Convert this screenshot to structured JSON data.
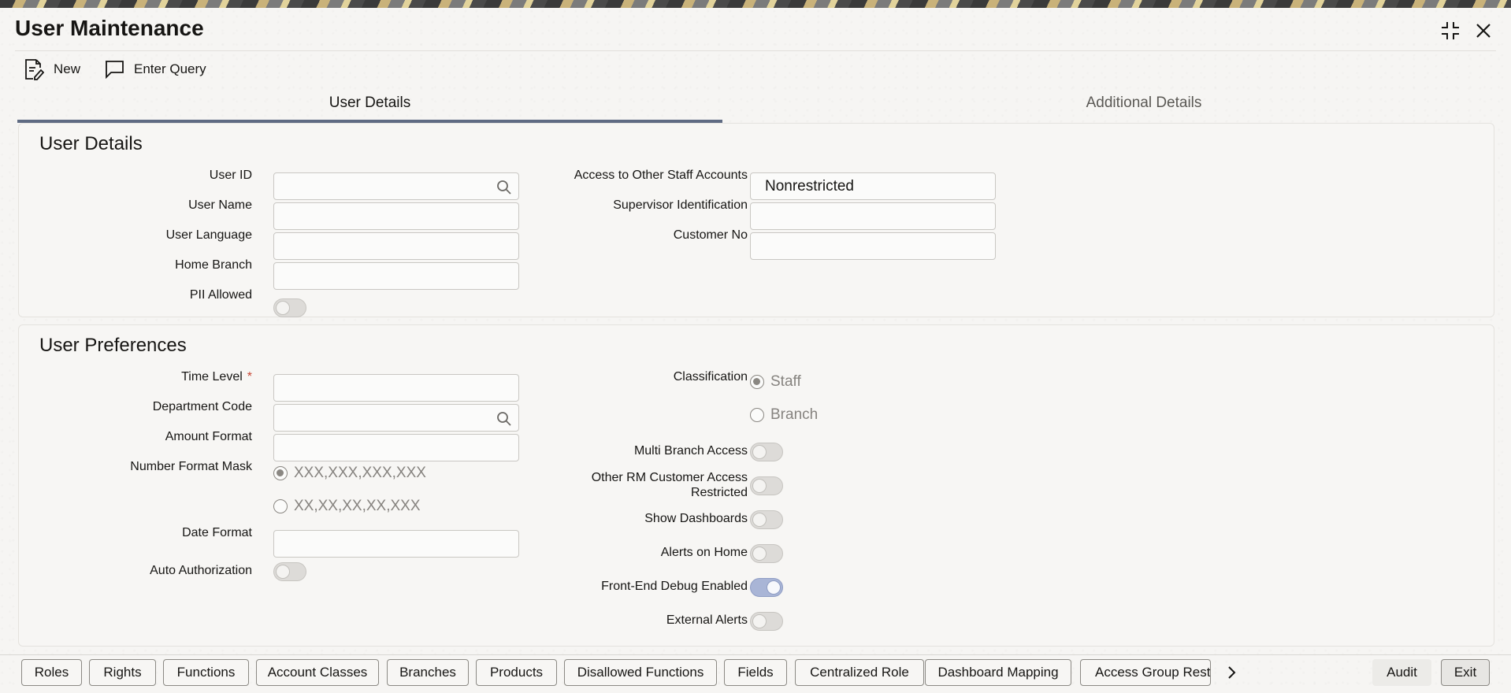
{
  "window": {
    "title": "User Maintenance"
  },
  "toolbar": {
    "new_label": "New",
    "enter_query_label": "Enter Query"
  },
  "tabs": [
    {
      "label": "User Details",
      "active": true
    },
    {
      "label": "Additional Details",
      "active": false
    }
  ],
  "user_details": {
    "section_title": "User Details",
    "user_id": {
      "label": "User ID",
      "value": ""
    },
    "user_name": {
      "label": "User Name",
      "value": ""
    },
    "user_language": {
      "label": "User Language",
      "value": ""
    },
    "home_branch": {
      "label": "Home Branch",
      "value": ""
    },
    "pii_allowed": {
      "label": "PII Allowed",
      "on": false
    },
    "access_other_staff": {
      "label": "Access to Other Staff Accounts",
      "value": "Nonrestricted"
    },
    "supervisor_id": {
      "label": "Supervisor Identification",
      "value": ""
    },
    "customer_no": {
      "label": "Customer No",
      "value": ""
    }
  },
  "user_preferences": {
    "section_title": "User Preferences",
    "time_level": {
      "label": "Time Level",
      "required_mark": "*",
      "value": ""
    },
    "department_code": {
      "label": "Department Code",
      "value": ""
    },
    "amount_format": {
      "label": "Amount Format",
      "value": ""
    },
    "number_format_mask": {
      "label": "Number Format Mask",
      "options": [
        "XXX,XXX,XXX,XXX",
        "XX,XX,XX,XX,XXX"
      ],
      "selected_index": 0
    },
    "date_format": {
      "label": "Date Format",
      "value": ""
    },
    "auto_authorization": {
      "label": "Auto Authorization",
      "on": false
    },
    "classification": {
      "label": "Classification",
      "options": [
        "Staff",
        "Branch"
      ],
      "selected_index": 0
    },
    "multi_branch_access": {
      "label": "Multi Branch Access",
      "on": false
    },
    "other_rm_access": {
      "label_line1": "Other RM Customer Access",
      "label_line2": "Restricted",
      "on": false
    },
    "show_dashboards": {
      "label": "Show Dashboards",
      "on": false
    },
    "alerts_on_home": {
      "label": "Alerts on Home",
      "on": false
    },
    "front_end_debug": {
      "label": "Front-End Debug Enabled",
      "on": true
    },
    "external_alerts": {
      "label": "External Alerts",
      "on": false
    }
  },
  "footer": {
    "buttons": [
      "Roles",
      "Rights",
      "Functions",
      "Account Classes",
      "Branches",
      "Products",
      "Disallowed Functions",
      "Fields",
      "Centralized Role",
      "Dashboard Mapping",
      "Access Group Restrictions"
    ],
    "audit_label": "Audit",
    "exit_label": "Exit"
  },
  "colors": {
    "accent_tab_underline": "#5f6b83",
    "toggle_on": "#a9b5d6",
    "required": "#c74634"
  },
  "icons": [
    "new-document-icon",
    "chat-bubble-icon",
    "search-icon",
    "minimize-icon",
    "close-icon",
    "chevron-right-icon"
  ]
}
